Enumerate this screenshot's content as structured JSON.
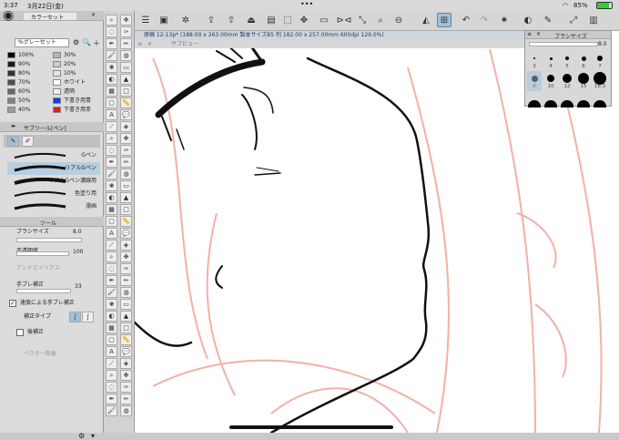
{
  "status": {
    "time": "3:37",
    "date": "3月22日(金)",
    "battery": "85%"
  },
  "colorset": {
    "tab": "カラーセット",
    "preset": "%グレーセット",
    "swatches": [
      {
        "label": "100%",
        "color": "#000000"
      },
      {
        "label": "30%",
        "color": "#b3b3b3"
      },
      {
        "label": "90%",
        "color": "#1a1a1a"
      },
      {
        "label": "20%",
        "color": "#cccccc"
      },
      {
        "label": "80%",
        "color": "#333333"
      },
      {
        "label": "10%",
        "color": "#e6e6e6"
      },
      {
        "label": "70%",
        "color": "#4d4d4d"
      },
      {
        "label": "ホワイト",
        "color": "#ffffff"
      },
      {
        "label": "60%",
        "color": "#666666"
      },
      {
        "label": "透明",
        "color": "#f0f0f0"
      },
      {
        "label": "50%",
        "color": "#808080"
      },
      {
        "label": "下書き用青",
        "color": "#1a37e6"
      },
      {
        "label": "40%",
        "color": "#999999"
      },
      {
        "label": "下書き用赤",
        "color": "#e61a1a"
      }
    ]
  },
  "subtool": {
    "tab": "サブツール[ペン]",
    "brushes": [
      "Gペン",
      "リアルGペン",
      "リアルGペン濃線用",
      "色塗り用",
      "漫画"
    ]
  },
  "toolprops": {
    "tab": "ツール",
    "brush_size_label": "ブラシサイズ",
    "brush_size": "8.0",
    "opacity_label": "不透明度",
    "opacity": "100",
    "antialias_label": "アンチエイリアス",
    "stabilization_label": "手ブレ補正",
    "stabilization": "33",
    "speed_stab_label": "速度による手ブレ補正",
    "correction_type_label": "補正タイプ",
    "post_correction_label": "後補正",
    "vector_label": "ベクター吸着"
  },
  "document": {
    "title": "原稿 12-13p* (188.00 x 263.00mm 製本サイズB5 判 182.00 x 257.00mm 600dpi 129.0%)",
    "subview": "サブビュー"
  },
  "brushsize_panel": {
    "title": "ブラシサイズ",
    "value": "8.0",
    "sizes": [
      "3",
      "4",
      "5",
      "6",
      "7",
      "8",
      "10",
      "12",
      "15",
      "18.3"
    ]
  }
}
